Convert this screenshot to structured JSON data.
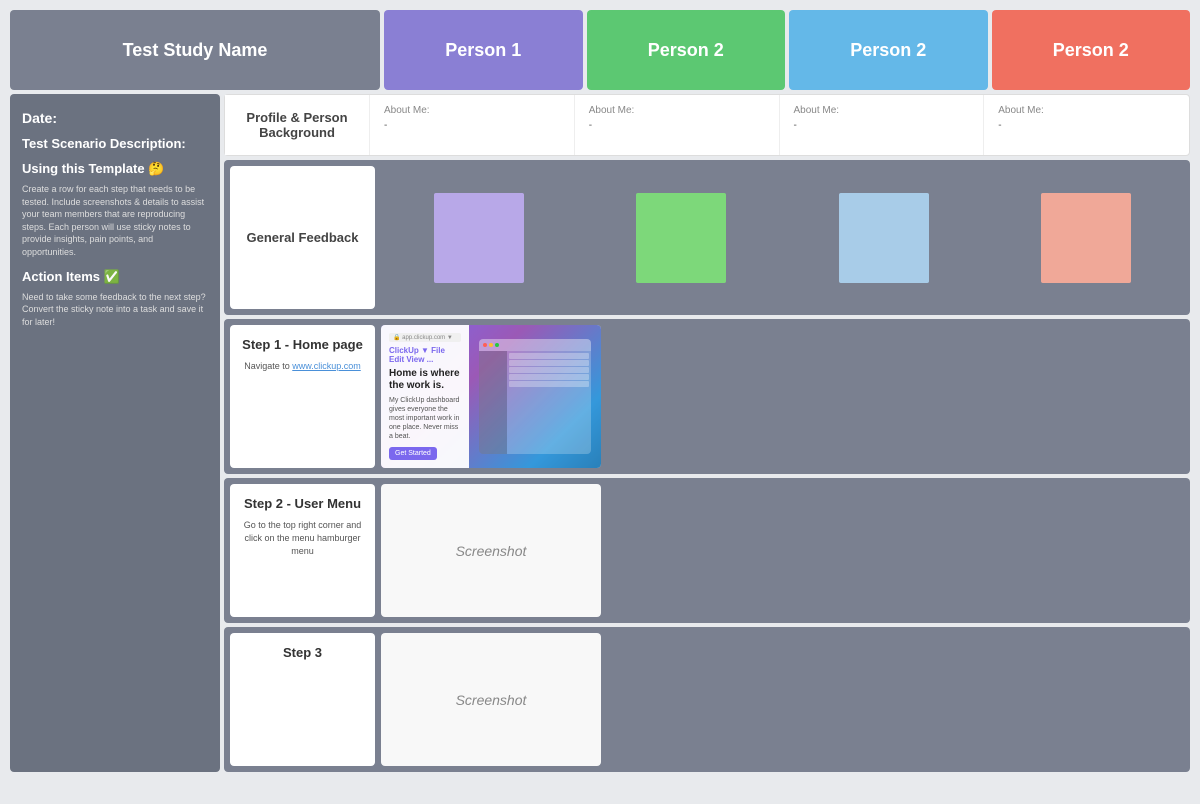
{
  "header": {
    "study_label": "Test Study Name",
    "person1_label": "Person 1",
    "person2a_label": "Person 2",
    "person2b_label": "Person 2",
    "person2c_label": "Person 2"
  },
  "sidebar": {
    "date_label": "Date:",
    "scenario_label": "Test Scenario Description:",
    "template_title": "Using this Template 🤔",
    "template_body": "Create a row for each step that needs to be tested. Include screenshots & details to assist your team members that are reproducing steps. Each person will use sticky notes to provide insights, pain points, and opportunities.",
    "action_label": "Action Items ✅",
    "action_body": "Need to take some feedback to the next step? Convert the sticky note into a task and save it for later!"
  },
  "profile": {
    "label": "Profile & Person Background",
    "cells": [
      {
        "about_label": "About Me:",
        "about_value": "-"
      },
      {
        "about_label": "About Me:",
        "about_value": "-"
      },
      {
        "about_label": "About Me:",
        "about_value": "-"
      },
      {
        "about_label": "About Me:",
        "about_value": "-"
      }
    ]
  },
  "feedback": {
    "label": "General Feedback"
  },
  "steps": [
    {
      "title": "Step 1 - Home page",
      "body": "Navigate to www.clickup.com",
      "link": "www.clickup.com",
      "screenshot_label": "",
      "has_screenshot": true
    },
    {
      "title": "Step 2 - User Menu",
      "body": "Go to the top right corner and click on the menu hamburger menu",
      "screenshot_label": "Screenshot",
      "has_screenshot": false
    },
    {
      "title": "Step 3",
      "body": "",
      "screenshot_label": "Screenshot",
      "has_screenshot": false
    }
  ]
}
